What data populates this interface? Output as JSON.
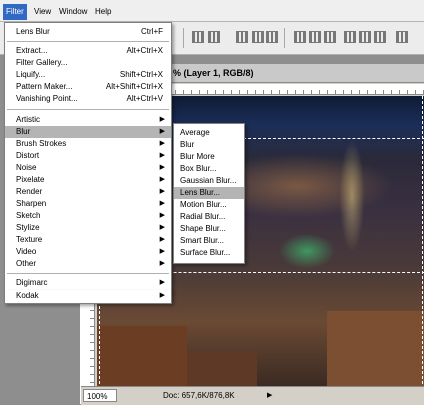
{
  "menubar": {
    "items": [
      "Filter",
      "View",
      "Window",
      "Help"
    ]
  },
  "document": {
    "title": "% (Layer 1, RGB/8)",
    "zoom": "100%",
    "doc_info": "Doc: 657,6K/876,8K"
  },
  "filter_menu": {
    "last_filter": {
      "label": "Lens Blur",
      "shortcut": "Ctrl+F"
    },
    "group1": [
      {
        "label": "Extract...",
        "shortcut": "Alt+Ctrl+X"
      },
      {
        "label": "Filter Gallery...",
        "shortcut": ""
      },
      {
        "label": "Liquify...",
        "shortcut": "Shift+Ctrl+X"
      },
      {
        "label": "Pattern Maker...",
        "shortcut": "Alt+Shift+Ctrl+X"
      },
      {
        "label": "Vanishing Point...",
        "shortcut": "Alt+Ctrl+V"
      }
    ],
    "group2": [
      "Artistic",
      "Blur",
      "Brush Strokes",
      "Distort",
      "Noise",
      "Pixelate",
      "Render",
      "Sharpen",
      "Sketch",
      "Stylize",
      "Texture",
      "Video",
      "Other"
    ],
    "group3": [
      "Digimarc",
      "Kodak"
    ]
  },
  "blur_submenu": {
    "items": [
      "Average",
      "Blur",
      "Blur More",
      "Box Blur...",
      "Gaussian Blur...",
      "Lens Blur...",
      "Motion Blur...",
      "Radial Blur...",
      "Shape Blur...",
      "Smart Blur...",
      "Surface Blur..."
    ],
    "highlighted": "Lens Blur..."
  },
  "icons": {
    "submenu_arrow": "triangle-right-icon"
  },
  "colors": {
    "menu_highlight": "#316ac5",
    "item_hover": "#b4b4b4"
  }
}
